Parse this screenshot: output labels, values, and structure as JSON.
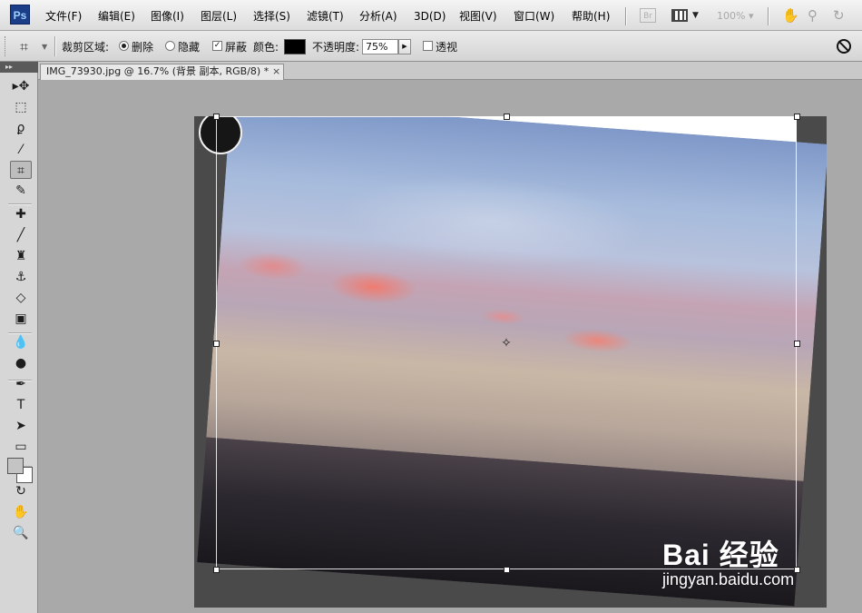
{
  "app": {
    "logo_text": "Ps"
  },
  "menu": [
    {
      "label": "文件(F)"
    },
    {
      "label": "编辑(E)"
    },
    {
      "label": "图像(I)"
    },
    {
      "label": "图层(L)"
    },
    {
      "label": "选择(S)"
    },
    {
      "label": "滤镜(T)"
    },
    {
      "label": "分析(A)"
    },
    {
      "label": "3D(D)"
    },
    {
      "label": "视图(V)"
    },
    {
      "label": "窗口(W)"
    },
    {
      "label": "帮助(H)"
    }
  ],
  "menubar_right": {
    "bridge_label": "Br",
    "zoom_value": "100%",
    "icons": [
      "hand-icon",
      "zoom-icon",
      "rotate-view-icon"
    ]
  },
  "options": {
    "crop_area_label": "裁剪区域:",
    "delete_label": "删除",
    "hide_label": "隐藏",
    "delete_selected": true,
    "shield_label": "屏蔽",
    "shield_checked": true,
    "color_label": "颜色:",
    "shield_color": "#000000",
    "opacity_label": "不透明度:",
    "opacity_value": "75%",
    "perspective_label": "透视",
    "perspective_checked": false
  },
  "tools": [
    {
      "name": "move-tool-icon",
      "glyph": "▸✥"
    },
    {
      "name": "marquee-tool-icon",
      "glyph": "⬚"
    },
    {
      "name": "lasso-tool-icon",
      "glyph": "ϼ"
    },
    {
      "name": "quick-selection-tool-icon",
      "glyph": "⁄"
    },
    {
      "name": "crop-tool-icon",
      "glyph": "⌗",
      "active": true
    },
    {
      "name": "ruler-tool-icon",
      "glyph": "✎"
    },
    {
      "name": "healing-brush-tool-icon",
      "glyph": "✚"
    },
    {
      "name": "brush-tool-icon",
      "glyph": "╱"
    },
    {
      "name": "clone-stamp-tool-icon",
      "glyph": "♜"
    },
    {
      "name": "history-brush-tool-icon",
      "glyph": "⚓"
    },
    {
      "name": "eraser-tool-icon",
      "glyph": "◇"
    },
    {
      "name": "gradient-tool-icon",
      "glyph": "▣"
    },
    {
      "name": "blur-tool-icon",
      "glyph": "💧"
    },
    {
      "name": "dodge-tool-icon",
      "glyph": "●"
    },
    {
      "name": "pen-tool-icon",
      "glyph": "✒"
    },
    {
      "name": "type-tool-icon",
      "glyph": "T"
    },
    {
      "name": "path-selection-tool-icon",
      "glyph": "➤"
    },
    {
      "name": "shape-tool-icon",
      "glyph": "▭"
    },
    {
      "name": "3d-rotate-tool-icon",
      "glyph": "⟲"
    },
    {
      "name": "3d-orbit-tool-icon",
      "glyph": "↻"
    },
    {
      "name": "hand-tool-icon",
      "glyph": "✋"
    },
    {
      "name": "zoom-tool-icon",
      "glyph": "🔍"
    }
  ],
  "colors": {
    "foreground": "#c4c4c4",
    "background": "#ffffff"
  },
  "document": {
    "tab_title": "IMG_73930.jpg @ 16.7% (背景 副本, RGB/8) *",
    "close_glyph": "×"
  },
  "watermark": {
    "logo": "Bai 经验",
    "url": "jingyan.baidu.com"
  }
}
